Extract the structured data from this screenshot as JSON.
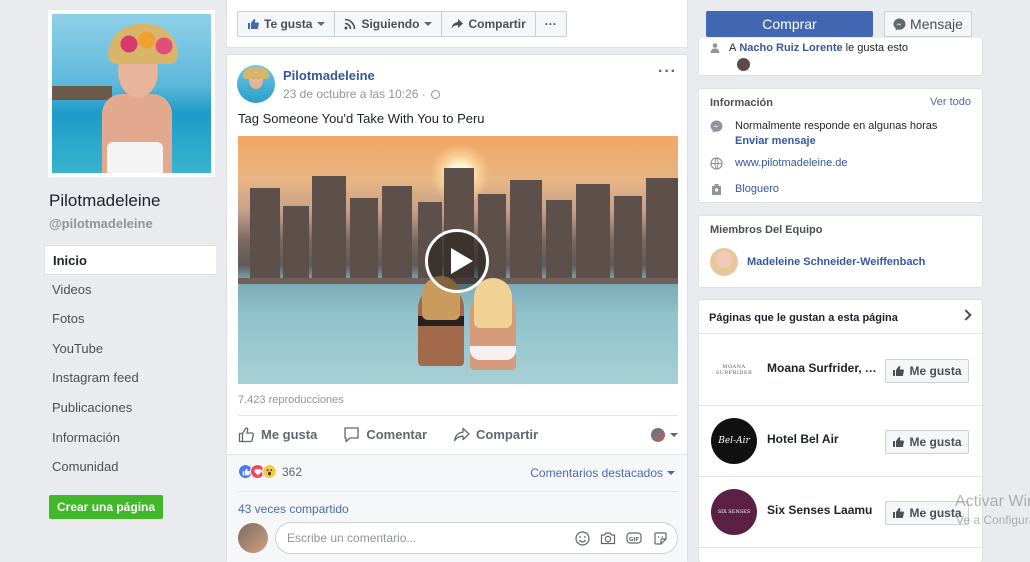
{
  "sidebar": {
    "page_name": "Pilotmadeleine",
    "handle": "@pilotmadeleine",
    "nav": [
      "Inicio",
      "Videos",
      "Fotos",
      "YouTube",
      "Instagram feed",
      "Publicaciones",
      "Información",
      "Comunidad"
    ],
    "active_index": 0,
    "create_page": "Crear una página"
  },
  "actionbar": {
    "like": "Te gusta",
    "following": "Siguiendo",
    "share": "Compartir",
    "more": "···"
  },
  "header_right": {
    "buy": "Comprar",
    "message": "Mensaje"
  },
  "post": {
    "author": "Pilotmadeleine",
    "time": "23 de octubre a las 10:26 ·",
    "more": "···",
    "text": "Tag Someone You'd Take With You to Peru",
    "views": "7.423 reproducciones",
    "actions": {
      "like": "Me gusta",
      "comment": "Comentar",
      "share": "Compartir"
    },
    "reaction_count": "362",
    "featured_comments": "Comentarios destacados",
    "shares": "43 veces compartido",
    "comment_placeholder": "Escribe un comentario..."
  },
  "likes_card": {
    "prefix": "A",
    "user": "Nacho Ruiz Lorente",
    "suffix": "le gusta esto"
  },
  "info_card": {
    "title": "Información",
    "see_all": "Ver todo",
    "response": "Normalmente responde en algunas horas",
    "send_message": "Enviar mensaje",
    "website": "www.pilotmadeleine.de",
    "category": "Bloguero"
  },
  "team_card": {
    "title": "Miembros Del Equipo",
    "member": "Madeleine Schneider-Weiffenbach"
  },
  "pages_card": {
    "title": "Páginas que le gustan a esta página",
    "like_label": "Me gusta",
    "pages": [
      {
        "name": "Moana Surfrider, A Westin Resort & Spa, Waikiki Beach",
        "logo_text": "MOANA SURFRIDER"
      },
      {
        "name": "Hotel Bel Air",
        "logo_text": "Bel-Air"
      },
      {
        "name": "Six Senses Laamu",
        "logo_text": "SIX SENSES"
      }
    ]
  },
  "watermark": {
    "line1": "Activar Windows",
    "line2": "Ve a Configuración"
  },
  "colors": {
    "fb_blue": "#4267b2",
    "link": "#365899",
    "green": "#42b72a",
    "background": "#e9ebee"
  }
}
